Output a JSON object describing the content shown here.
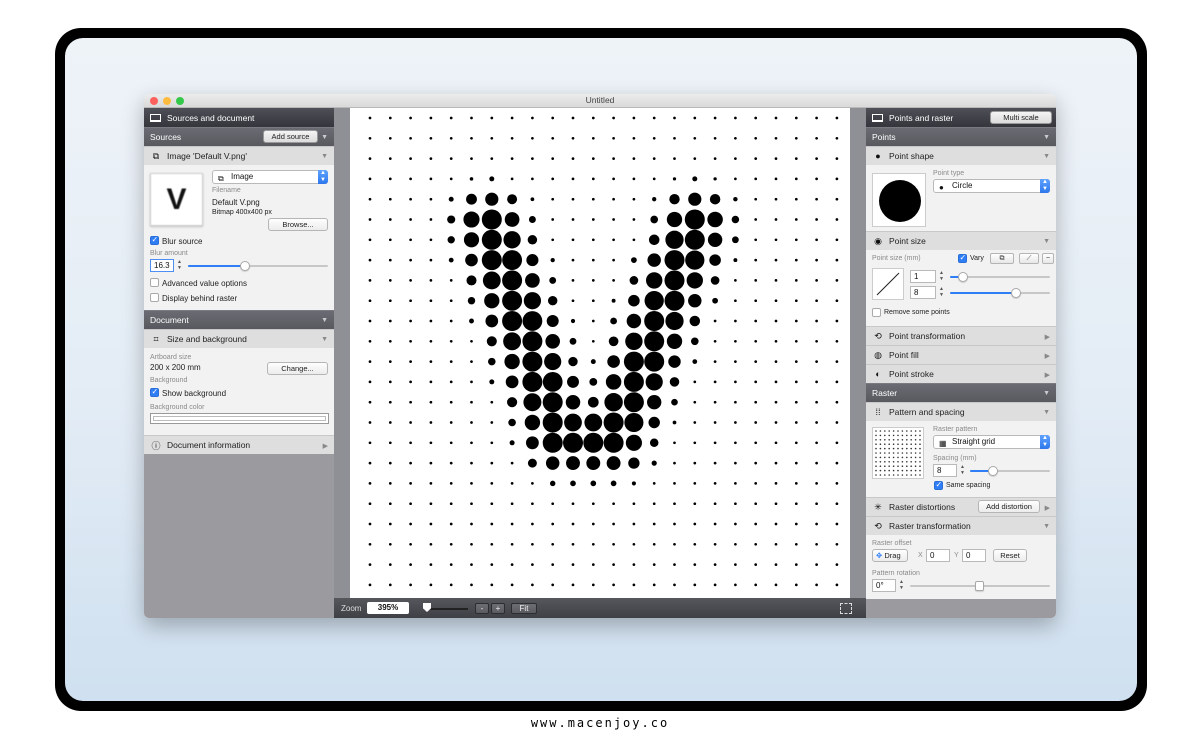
{
  "window": {
    "title": "Untitled"
  },
  "left": {
    "header": "Sources and document",
    "sources_label": "Sources",
    "add_source": "Add source",
    "image_section": "Image 'Default V.png'",
    "thumb_letter": "V",
    "source_type": "Image",
    "filename_label": "Filename",
    "filename": "Default V.png",
    "bitmap_info": "Bitmap 400x400 px",
    "browse": "Browse...",
    "blur_source": "Blur source",
    "blur_amount_label": "Blur amount",
    "blur_amount": "16.3",
    "blur_level": 0.41,
    "advanced": "Advanced value options",
    "display_behind": "Display behind raster",
    "document_label": "Document",
    "size_bg": "Size and background",
    "artboard_label": "Artboard size",
    "artboard_size": "200 x 200 mm",
    "change": "Change...",
    "background_label": "Background",
    "show_background": "Show background",
    "bg_color_label": "Background color",
    "doc_info": "Document information"
  },
  "right": {
    "header": "Points and raster",
    "multi_scale": "Multi scale",
    "points_label": "Points",
    "point_shape": "Point shape",
    "point_type_label": "Point type",
    "point_type": "Circle",
    "point_size": "Point size",
    "point_size_label": "Point size (mm)",
    "vary": "Vary",
    "size_min": "1",
    "size_max": "8",
    "remove_points": "Remove some points",
    "point_transformation": "Point transformation",
    "point_fill": "Point fill",
    "point_stroke": "Point stroke",
    "raster_label": "Raster",
    "pattern_spacing": "Pattern and spacing",
    "raster_pattern_label": "Raster pattern",
    "raster_pattern": "Straight grid",
    "spacing_label": "Spacing (mm)",
    "spacing": "8",
    "same_spacing": "Same spacing",
    "raster_distortions": "Raster distortions",
    "add_distortion": "Add distortion",
    "raster_transformation": "Raster transformation",
    "raster_offset_label": "Raster offset",
    "drag": "Drag",
    "x_label": "X",
    "x_value": "0",
    "y_label": "Y",
    "y_value": "0",
    "reset": "Reset",
    "pattern_rotation_label": "Pattern rotation",
    "rotation": "0°"
  },
  "zoom": {
    "label": "Zoom",
    "value": "395%",
    "minus": "-",
    "plus": "+",
    "fit": "Fit"
  },
  "footer": "www.macenjoy.co",
  "colors": {
    "accent": "#2f7ef6",
    "panel": "#9a9a9f",
    "header": "#3a3b41"
  }
}
